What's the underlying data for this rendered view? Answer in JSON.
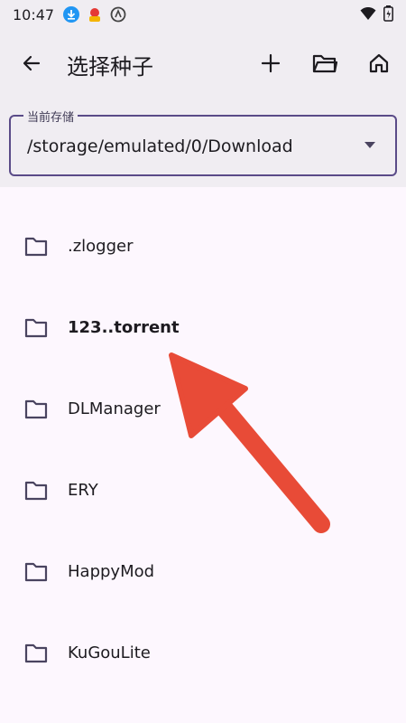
{
  "status_bar": {
    "time": "10:47"
  },
  "app_bar": {
    "title": "选择种子"
  },
  "storage": {
    "label": "当前存储",
    "value": "/storage/emulated/0/Download"
  },
  "files": [
    {
      "name": ".zlogger",
      "bold": false
    },
    {
      "name": "123..torrent",
      "bold": true
    },
    {
      "name": "DLManager",
      "bold": false
    },
    {
      "name": "ERY",
      "bold": false
    },
    {
      "name": "HappyMod",
      "bold": false
    },
    {
      "name": "KuGouLite",
      "bold": false
    }
  ],
  "colors": {
    "accent": "#5a4b88",
    "arrow": "#e84b37",
    "background": "#fdf7fe",
    "header_bg": "#f0edf2"
  }
}
